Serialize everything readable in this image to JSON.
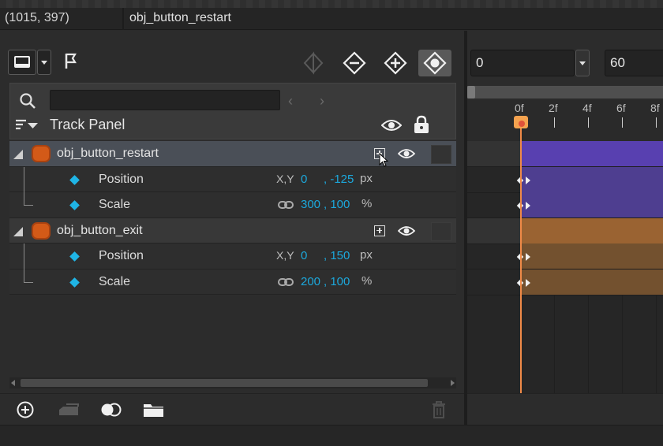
{
  "status": {
    "coords": "(1015, 397)",
    "object": "obj_button_restart"
  },
  "search": {
    "placeholder": ""
  },
  "track_panel": {
    "title": "Track Panel"
  },
  "tracks": [
    {
      "name": "obj_button_restart",
      "selected": true,
      "properties": [
        {
          "name": "Position",
          "type": "X,Y",
          "v1": "0",
          "v2": ", -125",
          "unit": "px"
        },
        {
          "name": "Scale",
          "type": "link-icon",
          "v1": "300",
          "v2": ", 100",
          "unit": "%"
        }
      ]
    },
    {
      "name": "obj_button_exit",
      "selected": false,
      "properties": [
        {
          "name": "Position",
          "type": "X,Y",
          "v1": "0",
          "v2": ", 150",
          "unit": "px"
        },
        {
          "name": "Scale",
          "type": "link-icon",
          "v1": "200",
          "v2": ", 100",
          "unit": "%"
        }
      ]
    }
  ],
  "timeline": {
    "current_frame": "0",
    "end_frame": "60",
    "ruler_labels": [
      "0f",
      "2f",
      "4f",
      "6f",
      "8f"
    ]
  },
  "colors": {
    "accent_blue": "#1ca8dc",
    "track_purple": "#5840b0",
    "track_orange": "#9a6332",
    "playhead": "#f08a48"
  }
}
